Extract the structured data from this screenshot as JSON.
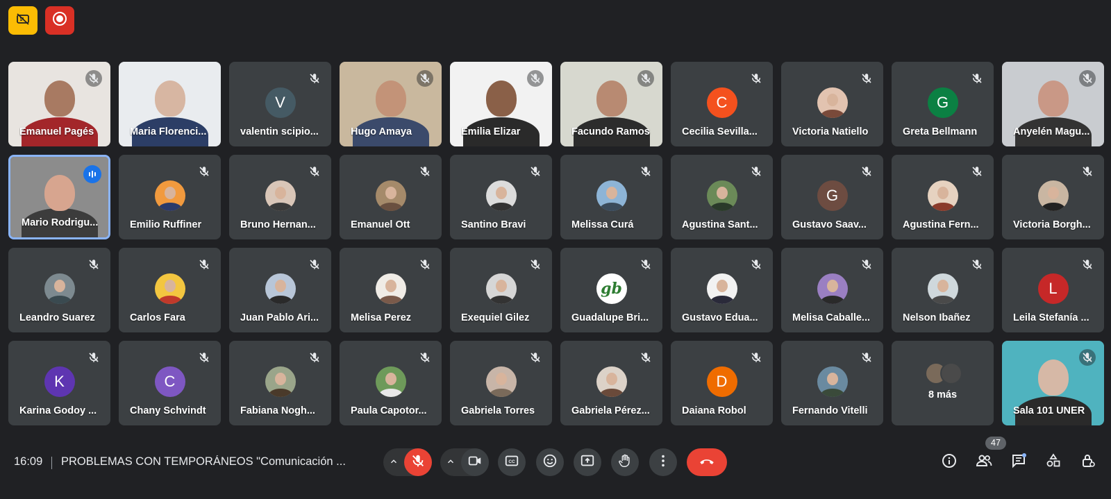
{
  "participants": [
    {
      "name": "Emanuel Pagés",
      "type": "video",
      "bg": "#e8e4e0",
      "skin": "#a87a62",
      "shirt": "#a3262a",
      "muted": true
    },
    {
      "name": "Maria Florenci...",
      "type": "video",
      "bg": "#e9ecef",
      "skin": "#d7b6a2",
      "shirt": "#2c3e66",
      "muted": false
    },
    {
      "name": "valentin scipio...",
      "type": "avatar",
      "letter": "V",
      "color": "#455a64",
      "muted": true
    },
    {
      "name": "Hugo Amaya",
      "type": "video",
      "bg": "#c9b89e",
      "skin": "#c39378",
      "shirt": "#3b4a6b",
      "muted": true
    },
    {
      "name": "Emilia Elizar",
      "type": "video",
      "bg": "#f2f2f2",
      "skin": "#8a6048",
      "shirt": "#2a2a2a",
      "muted": true
    },
    {
      "name": "Facundo Ramos",
      "type": "video",
      "bg": "#d7d8cf",
      "skin": "#b88a72",
      "shirt": "#2c2c2c",
      "muted": true
    },
    {
      "name": "Cecilia Sevilla...",
      "type": "avatar",
      "letter": "C",
      "color": "#f4511e",
      "muted": true
    },
    {
      "name": "Victoria Natiello",
      "type": "photo",
      "color": "#e2c3b0",
      "body": "#7a4a3a",
      "muted": true
    },
    {
      "name": "Greta Bellmann",
      "type": "avatar",
      "letter": "G",
      "color": "#0b8043",
      "muted": true
    },
    {
      "name": "Anyelén Magu...",
      "type": "video",
      "bg": "#c9ccd0",
      "skin": "#c99886",
      "shirt": "#333333",
      "muted": true
    },
    {
      "name": "Mario Rodrigu...",
      "type": "video",
      "bg": "#8c8c8c",
      "skin": "#d7a58f",
      "shirt": "#3c3c3c",
      "muted": false,
      "speaking": true
    },
    {
      "name": "Emilio Ruffiner",
      "type": "photo",
      "color": "#f19a3e",
      "body": "#2a3a6a",
      "muted": true
    },
    {
      "name": "Bruno Hernan...",
      "type": "photo",
      "color": "#d9c6b8",
      "body": "#3a3a3a",
      "muted": true
    },
    {
      "name": "Emanuel Ott",
      "type": "photo",
      "color": "#a58a6a",
      "body": "#6a5040",
      "muted": true
    },
    {
      "name": "Santino Bravi",
      "type": "photo",
      "color": "#dcdcdc",
      "body": "#333333",
      "muted": true
    },
    {
      "name": "Melissa Curá",
      "type": "photo",
      "color": "#8db4d6",
      "body": "#3a4a5a",
      "muted": true
    },
    {
      "name": "Agustina Sant...",
      "type": "photo",
      "color": "#6b8a58",
      "body": "#2a3a2a",
      "muted": true
    },
    {
      "name": "Gustavo Saav...",
      "type": "avatar",
      "letter": "G",
      "color": "#6d4c41",
      "muted": true
    },
    {
      "name": "Agustina Fern...",
      "type": "photo",
      "color": "#e6d2c0",
      "body": "#8a3a2a",
      "muted": true
    },
    {
      "name": "Victoria Borgh...",
      "type": "photo",
      "color": "#c9b6a2",
      "body": "#222222",
      "muted": true
    },
    {
      "name": "Leandro Suarez",
      "type": "photo",
      "color": "#7d8a90",
      "body": "#3a4a50",
      "muted": true
    },
    {
      "name": "Carlos Fara",
      "type": "photo",
      "color": "#f3c640",
      "body": "#c0392b",
      "muted": true
    },
    {
      "name": "Juan Pablo Ari...",
      "type": "photo",
      "color": "#b8c6d8",
      "body": "#2a2a2a",
      "muted": true
    },
    {
      "name": "Melisa Perez",
      "type": "photo",
      "color": "#f0ece6",
      "body": "#7a5a4a",
      "muted": true
    },
    {
      "name": "Exequiel Gilez",
      "type": "photo",
      "color": "#d6d6d6",
      "body": "#333333",
      "muted": true
    },
    {
      "name": "Guadalupe Bri...",
      "type": "logo",
      "color": "#ffffff",
      "text": "gb",
      "textColor": "#2e7d32",
      "muted": true
    },
    {
      "name": "Gustavo Edua...",
      "type": "photo",
      "color": "#f2f2f2",
      "body": "#2a2a3a",
      "muted": true
    },
    {
      "name": "Melisa Caballe...",
      "type": "photo",
      "color": "#9a7fc2",
      "body": "#2a2a2a",
      "muted": true
    },
    {
      "name": "Nelson Ibañez",
      "type": "photo",
      "color": "#cfd8dc",
      "body": "#4a4a4a",
      "muted": true
    },
    {
      "name": "Leila Stefanía ...",
      "type": "avatar",
      "letter": "L",
      "color": "#c62828",
      "muted": true
    },
    {
      "name": "Karina Godoy ...",
      "type": "avatar",
      "letter": "K",
      "color": "#5e35b1",
      "muted": true
    },
    {
      "name": "Chany Schvindt",
      "type": "avatar",
      "letter": "C",
      "color": "#7e57c2",
      "muted": true
    },
    {
      "name": "Fabiana Nogh...",
      "type": "photo",
      "color": "#9aa58a",
      "body": "#4a3a2a",
      "muted": true
    },
    {
      "name": "Paula Capotor...",
      "type": "photo",
      "color": "#6e9a5a",
      "body": "#e8e8e8",
      "muted": true
    },
    {
      "name": "Gabriela Torres",
      "type": "photo",
      "color": "#c8b5a8",
      "body": "#7a6a5a",
      "muted": true
    },
    {
      "name": "Gabriela Pérez...",
      "type": "photo",
      "color": "#dcd2c8",
      "body": "#6a4a3a",
      "muted": true
    },
    {
      "name": "Daiana Robol",
      "type": "avatar",
      "letter": "D",
      "color": "#ef6c00",
      "muted": true
    },
    {
      "name": "Fernando Vitelli",
      "type": "photo",
      "color": "#6a8aa0",
      "body": "#3a4a3a",
      "muted": true
    },
    {
      "name": "8 más",
      "type": "more",
      "muted": false
    },
    {
      "name": "Sala 101 UNER",
      "type": "video",
      "bg": "#4fb3bf",
      "skin": "#d6b8a6",
      "shirt": "#2a2a2a",
      "muted": true
    }
  ],
  "bottombar": {
    "time": "16:09",
    "meeting_title": "PROBLEMAS CON TEMPORÁNEOS \"Comunicación ...",
    "participant_count": "47"
  },
  "colors": {
    "accent_red": "#ea4335",
    "accent_blue": "#8ab4f8",
    "background": "#202124",
    "tile": "#3c4043"
  },
  "icons": {
    "top_left": "no-camera-warning-icon",
    "top_right": "recording-icon"
  }
}
